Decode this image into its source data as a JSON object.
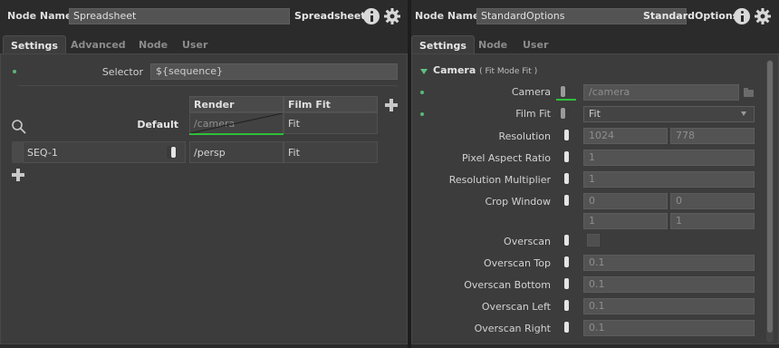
{
  "left": {
    "node_name_label": "Node Name",
    "node_name_value": "Spreadsheet",
    "node_type": "Spreadsheet",
    "tabs": [
      {
        "label": "Settings",
        "active": true
      },
      {
        "label": "Advanced",
        "active": false
      },
      {
        "label": "Node",
        "active": false
      },
      {
        "label": "User",
        "active": false
      }
    ],
    "selector_label": "Selector",
    "selector_value": "${sequence}",
    "columns": [
      "Render Camera",
      "Film Fit"
    ],
    "default_row": {
      "label": "Default",
      "render_camera": "/camera",
      "film_fit": "Fit"
    },
    "rows": [
      {
        "name": "SEQ-1",
        "render_camera": "/persp",
        "film_fit": "Fit"
      }
    ]
  },
  "right": {
    "node_name_label": "Node Name",
    "node_name_value": "StandardOptions",
    "node_type": "StandardOptions",
    "tabs": [
      {
        "label": "Settings",
        "active": true
      },
      {
        "label": "Node",
        "active": false
      },
      {
        "label": "User",
        "active": false
      }
    ],
    "section_title": "Camera",
    "section_subtitle": "( Fit Mode Fit )",
    "fields": {
      "camera": {
        "label": "Camera",
        "value": "/camera"
      },
      "film_fit": {
        "label": "Film Fit",
        "value": "Fit"
      },
      "resolution": {
        "label": "Resolution",
        "x": "1024",
        "y": "778"
      },
      "pixel_aspect": {
        "label": "Pixel Aspect Ratio",
        "value": "1"
      },
      "resolution_multiplier": {
        "label": "Resolution Multiplier",
        "value": "1"
      },
      "crop_window": {
        "label": "Crop Window",
        "min_x": "0",
        "min_y": "0",
        "max_x": "1",
        "max_y": "1"
      },
      "overscan": {
        "label": "Overscan"
      },
      "overscan_top": {
        "label": "Overscan Top",
        "value": "0.1"
      },
      "overscan_bottom": {
        "label": "Overscan Bottom",
        "value": "0.1"
      },
      "overscan_left": {
        "label": "Overscan Left",
        "value": "0.1"
      },
      "overscan_right": {
        "label": "Overscan Right",
        "value": "0.1"
      }
    }
  },
  "colors": {
    "accent_green": "#59b877",
    "active_line": "#2fbf3a",
    "panel_bg": "#3c3c3c",
    "field_bg": "#535353"
  }
}
